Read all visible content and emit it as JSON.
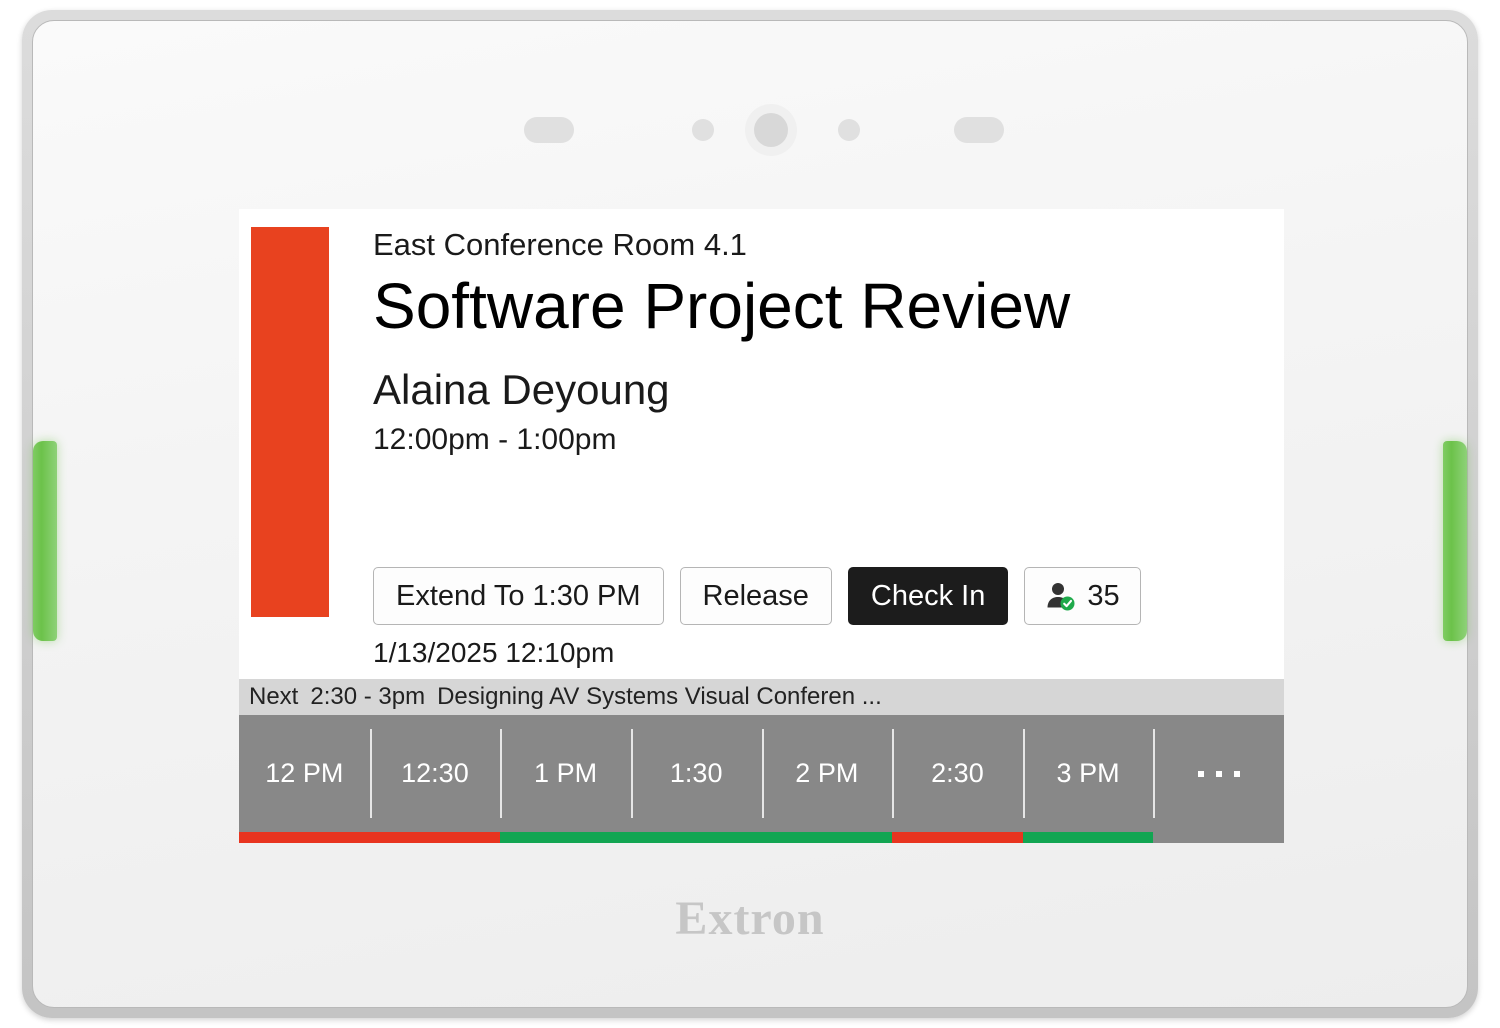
{
  "device": {
    "brand": "Extron",
    "led_color": "#6cc24a",
    "hardware": {
      "speaker_left": "speaker-slot",
      "speaker_right": "speaker-slot",
      "sensor_left": "sensor-dot",
      "sensor_right": "sensor-dot",
      "camera": "camera-lens"
    }
  },
  "screen": {
    "accent_color": "#e8421f",
    "room_name": "East Conference Room 4.1",
    "meeting_title": "Software Project Review",
    "organizer": "Alaina Deyoung",
    "meeting_time": "12:00pm - 1:00pm",
    "datetime_stamp": "1/13/2025  12:10pm",
    "actions": [
      {
        "label": "Extend To 1:30 PM",
        "style": "default",
        "name": "extend-button"
      },
      {
        "label": "Release",
        "style": "default",
        "name": "release-button"
      },
      {
        "label": "Check In",
        "style": "primary",
        "name": "check-in-button"
      }
    ],
    "occupancy": {
      "count": "35",
      "icon": "person-check-icon",
      "icon_color": "#333333",
      "badge_color": "#1faa4b"
    },
    "next_meeting": {
      "label": "Next",
      "time": "2:30 - 3pm",
      "title": "Designing AV Systems Visual Conferen ..."
    },
    "timeline": {
      "slots": [
        "12 PM",
        "12:30",
        "1 PM",
        "1:30",
        "2 PM",
        "2:30",
        "3 PM"
      ],
      "overflow_indicator": "...",
      "background": "#888888"
    },
    "availability": {
      "busy_color": "#e8341f",
      "free_color": "#12a552",
      "unknown_color": "#888888",
      "segments": [
        {
          "status": "busy",
          "width_pct": 25
        },
        {
          "status": "free",
          "width_pct": 37.5
        },
        {
          "status": "busy",
          "width_pct": 12.5
        },
        {
          "status": "free",
          "width_pct": 12.5
        },
        {
          "status": "unknown",
          "width_pct": 12.5
        }
      ]
    }
  }
}
